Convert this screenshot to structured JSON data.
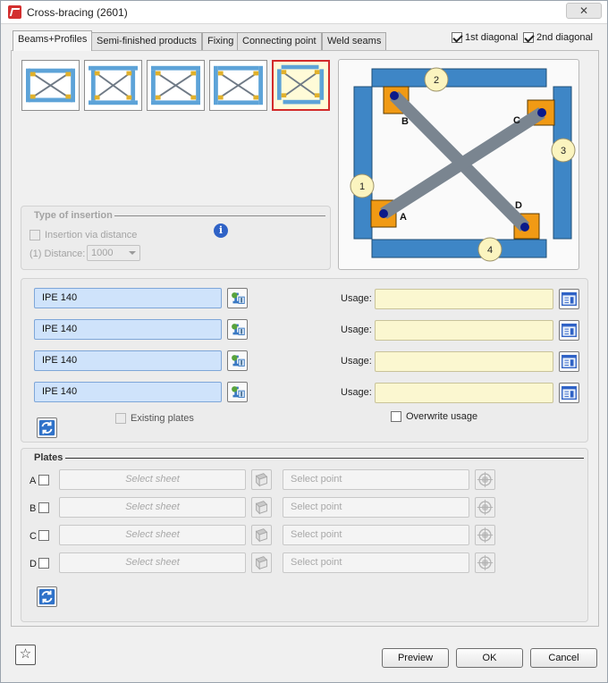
{
  "window": {
    "title": "Cross-bracing (2601)",
    "close_glyph": "✕"
  },
  "tabs": [
    {
      "label": "Beams+Profiles",
      "active": true
    },
    {
      "label": "Semi-finished products",
      "active": false
    },
    {
      "label": "Fixing",
      "active": false
    },
    {
      "label": "Connecting point",
      "active": false
    },
    {
      "label": "Weld seams",
      "active": false
    }
  ],
  "diagonals": {
    "first": {
      "label": "1st diagonal",
      "checked": true
    },
    "second": {
      "label": "2nd diagonal",
      "checked": true
    }
  },
  "variants": {
    "count": 5,
    "selected_index": 4
  },
  "preview": {
    "beam_numbers": [
      "1",
      "2",
      "3",
      "4"
    ],
    "point_labels": [
      "A",
      "B",
      "C",
      "D"
    ],
    "colors": {
      "beam": "#3e86c6",
      "plate": "#f19a14",
      "diagonal": "#7a8590",
      "badge": "#fbf4bf",
      "point": "#0a1a8a"
    }
  },
  "insertion": {
    "title": "Type of insertion",
    "via_distance_label": "Insertion via distance",
    "distance_label": "(1) Distance:",
    "distance_value": "1000",
    "info_icon": "info-icon"
  },
  "profiles": {
    "rows": [
      {
        "profile": "IPE 140",
        "usage_label": "Usage:",
        "usage_value": ""
      },
      {
        "profile": "IPE 140",
        "usage_label": "Usage:",
        "usage_value": ""
      },
      {
        "profile": "IPE 140",
        "usage_label": "Usage:",
        "usage_value": ""
      },
      {
        "profile": "IPE 140",
        "usage_label": "Usage:",
        "usage_value": ""
      }
    ],
    "existing_plates_label": "Existing plates",
    "overwrite_usage_label": "Overwrite usage"
  },
  "plates": {
    "title": "Plates",
    "rows": [
      {
        "letter": "A",
        "sheet_placeholder": "Select sheet",
        "point_placeholder": "Select point"
      },
      {
        "letter": "B",
        "sheet_placeholder": "Select sheet",
        "point_placeholder": "Select point"
      },
      {
        "letter": "C",
        "sheet_placeholder": "Select sheet",
        "point_placeholder": "Select point"
      },
      {
        "letter": "D",
        "sheet_placeholder": "Select sheet",
        "point_placeholder": "Select point"
      }
    ]
  },
  "footer": {
    "preview": "Preview",
    "ok": "OK",
    "cancel": "Cancel",
    "favorites_icon": "star-icon"
  }
}
